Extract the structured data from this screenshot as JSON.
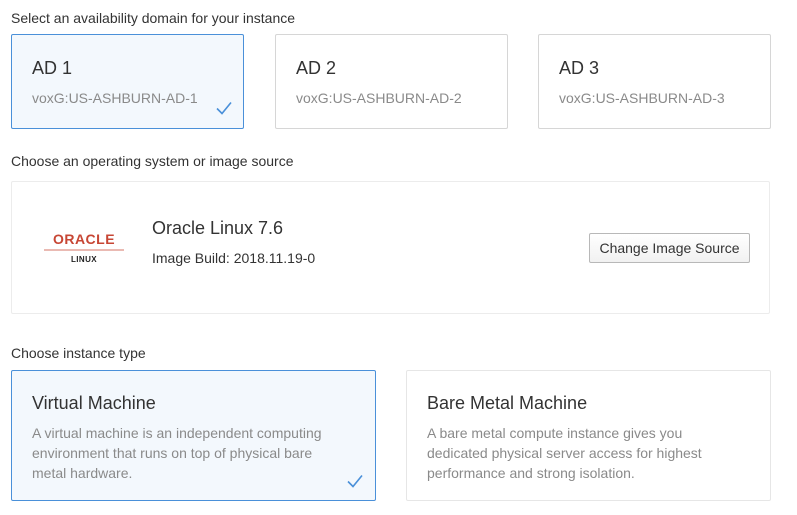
{
  "availability": {
    "label": "Select an availability domain for your instance",
    "domains": [
      {
        "name": "AD 1",
        "id": "voxG:US-ASHBURN-AD-1",
        "selected": true
      },
      {
        "name": "AD 2",
        "id": "voxG:US-ASHBURN-AD-2",
        "selected": false
      },
      {
        "name": "AD 3",
        "id": "voxG:US-ASHBURN-AD-3",
        "selected": false
      }
    ]
  },
  "image_source": {
    "label": "Choose an operating system or image source",
    "logo_text": "ORACLE",
    "logo_subtext": "LINUX",
    "os_name": "Oracle Linux 7.6",
    "build": "Image Build: 2018.11.19-0",
    "change_button": "Change Image Source"
  },
  "instance_type": {
    "label": "Choose instance type",
    "options": [
      {
        "title": "Virtual Machine",
        "description": "A virtual machine is an independent computing environment that runs on top of physical bare metal hardware.",
        "selected": true
      },
      {
        "title": "Bare Metal Machine",
        "description": "A bare metal compute instance gives you dedicated physical server access for highest performance and strong isolation.",
        "selected": false
      }
    ]
  },
  "colors": {
    "accent": "#4a90d9",
    "oracle_red": "#c74634",
    "selected_bg": "#f3f8fd"
  }
}
